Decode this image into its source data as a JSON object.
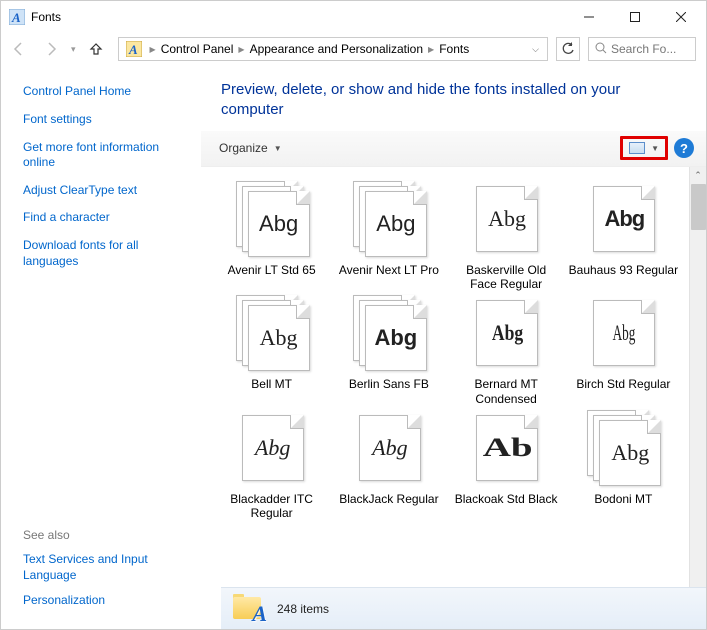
{
  "window": {
    "title": "Fonts"
  },
  "breadcrumb": [
    "Control Panel",
    "Appearance and Personalization",
    "Fonts"
  ],
  "search": {
    "placeholder": "Search Fo..."
  },
  "sidebar": {
    "home": "Control Panel Home",
    "links": [
      "Font settings",
      "Get more font information online",
      "Adjust ClearType text",
      "Find a character",
      "Download fonts for all languages"
    ],
    "see_also_label": "See also",
    "see_also": [
      "Text Services and Input Language",
      "Personalization"
    ]
  },
  "heading": "Preview, delete, or show and hide the fonts installed on your computer",
  "toolbar": {
    "organize": "Organize"
  },
  "fonts": [
    {
      "label": "Avenir LT Std 65",
      "sample": "Abg",
      "stack": true,
      "style": "font-family:Arial;"
    },
    {
      "label": "Avenir Next LT Pro",
      "sample": "Abg",
      "stack": true,
      "style": "font-family:Arial;"
    },
    {
      "label": "Baskerville Old Face Regular",
      "sample": "Abg",
      "stack": false,
      "style": "font-family:'Times New Roman',serif;"
    },
    {
      "label": "Bauhaus 93 Regular",
      "sample": "Abg",
      "stack": false,
      "style": "font-family:Arial;font-weight:900;letter-spacing:-1px;"
    },
    {
      "label": "Bell MT",
      "sample": "Abg",
      "stack": true,
      "style": "font-family:'Times New Roman',serif;"
    },
    {
      "label": "Berlin Sans FB",
      "sample": "Abg",
      "stack": true,
      "style": "font-family:Arial;font-weight:bold;"
    },
    {
      "label": "Bernard MT Condensed",
      "sample": "Abg",
      "stack": false,
      "style": "font-family:'Times New Roman',serif;font-weight:900;transform:scaleX(0.8);"
    },
    {
      "label": "Birch Std Regular",
      "sample": "Abg",
      "stack": false,
      "style": "font-family:'Times New Roman',serif;transform:scaleX(0.6);"
    },
    {
      "label": "Blackadder ITC Regular",
      "sample": "Abg",
      "stack": false,
      "style": "font-family:cursive;font-style:italic;"
    },
    {
      "label": "BlackJack Regular",
      "sample": "Abg",
      "stack": false,
      "style": "font-family:cursive;font-style:italic;"
    },
    {
      "label": "Blackoak Std Black",
      "sample": "Ab",
      "stack": false,
      "style": "font-family:'Times New Roman',serif;font-weight:900;transform:scaleX(1.5);font-size:26px;"
    },
    {
      "label": "Bodoni MT",
      "sample": "Abg",
      "stack": true,
      "style": "font-family:'Times New Roman',serif;"
    }
  ],
  "status": {
    "count": "248 items"
  }
}
